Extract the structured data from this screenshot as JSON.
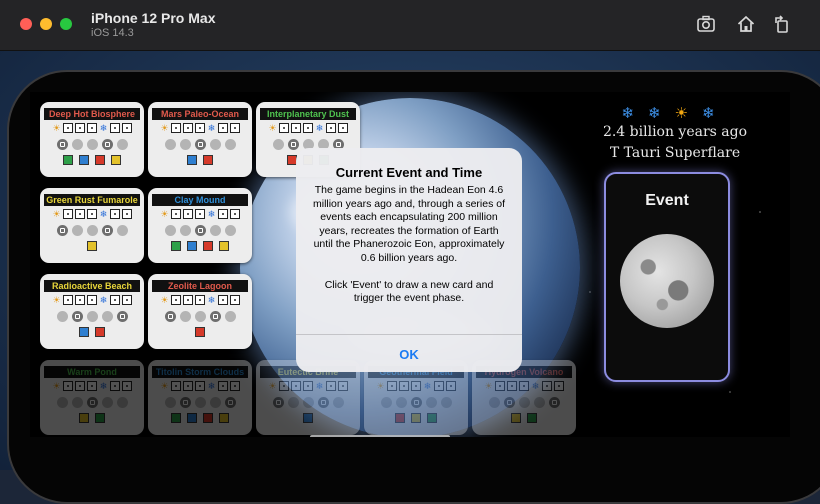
{
  "simulator": {
    "device_name": "iPhone 12 Pro Max",
    "os_version": "iOS 14.3",
    "toolbar_icons": [
      "screenshot-icon",
      "home-icon",
      "rotate-icon"
    ]
  },
  "game": {
    "status": {
      "icons": [
        "snowflake-icon",
        "snowflake-icon",
        "sun-icon",
        "snowflake-icon"
      ],
      "era_text": "2.4 billion years ago",
      "event_name": "T Tauri Superflare"
    },
    "event_button_label": "Event",
    "cards": [
      {
        "name": "Deep Hot Biosphere",
        "color": "#e15a4c"
      },
      {
        "name": "Mars Paleo-Ocean",
        "color": "#e15a4c"
      },
      {
        "name": "Interplanetary Dust",
        "color": "#4fc24f"
      },
      {
        "name": "Green Rust Fumarole",
        "color": "#e8d63a"
      },
      {
        "name": "Clay Mound",
        "color": "#2f8fd8"
      },
      {
        "name": "Radioactive Beach",
        "color": "#e8d63a"
      },
      {
        "name": "Zeolite Lagoon",
        "color": "#e15a4c"
      },
      {
        "name": "Warm Pond",
        "color": "#4fc24f"
      },
      {
        "name": "Titolin Storm Clouds",
        "color": "#2f8fd8"
      },
      {
        "name": "Eutectic Brine",
        "color": "#e8d63a"
      },
      {
        "name": "Geothermal Field",
        "color": "#2f8fd8"
      },
      {
        "name": "Hydrogen Volcano",
        "color": "#e15a4c"
      }
    ],
    "alert": {
      "title": "Current Event and Time",
      "message": "The game begins in the Hadean Eon 4.6 million years ago and, through a series of events each encapsulating 200 million years, recreates the formation of Earth until the Phanerozoic Eon, approximately 0.6 billion years ago.\n\nClick 'Event' to draw a new card and trigger the event phase.",
      "ok_label": "OK"
    }
  }
}
